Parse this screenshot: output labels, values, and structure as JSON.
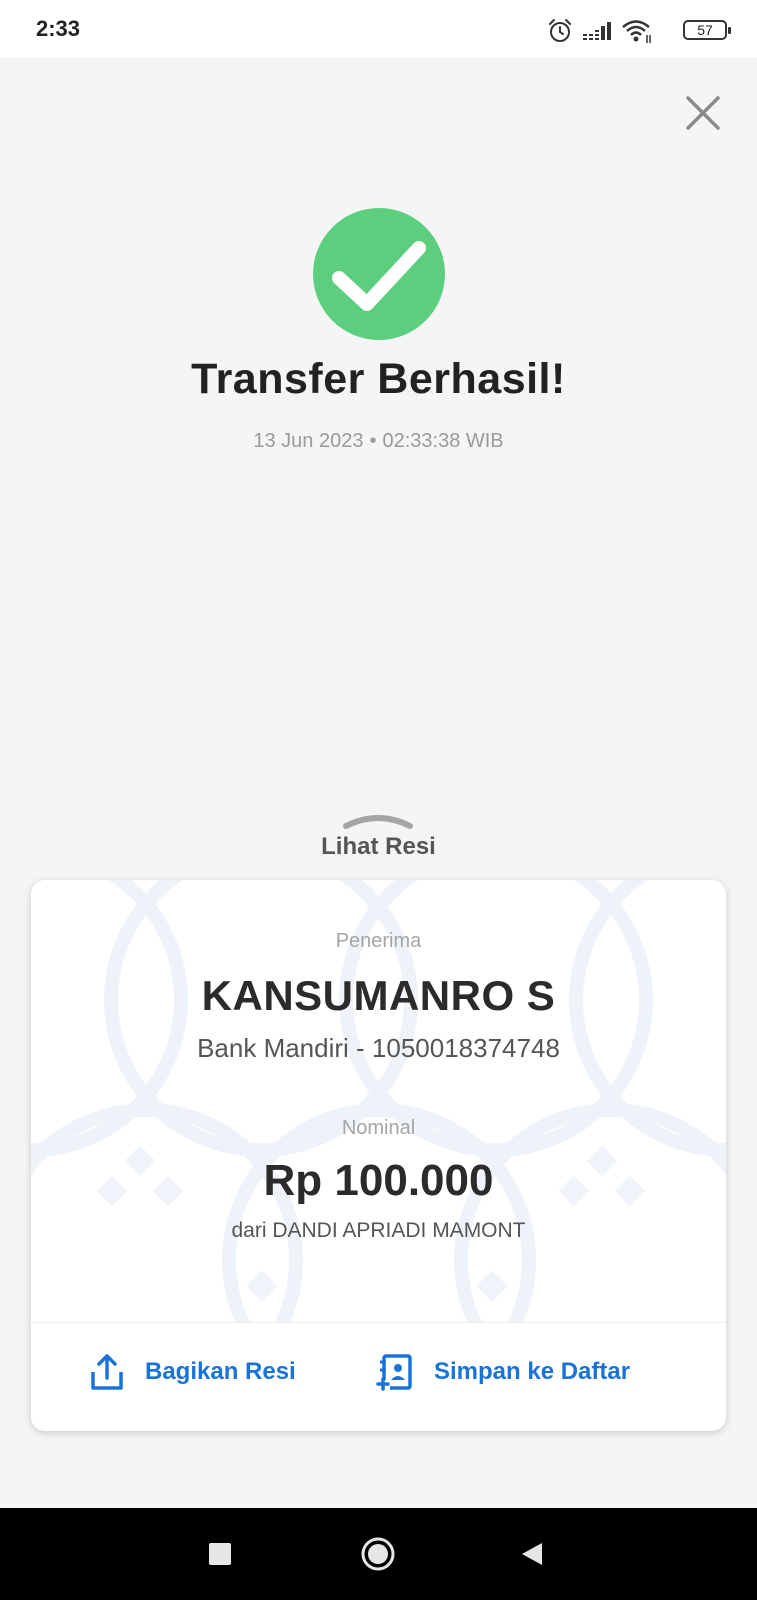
{
  "status_bar": {
    "time": "2:33",
    "battery_level": "57",
    "icons": [
      "alarm-icon",
      "signal-icon",
      "wifi-icon",
      "battery-icon"
    ]
  },
  "header": {
    "close_icon": "close-icon"
  },
  "success": {
    "icon": "check-circle-icon",
    "color": "#5ccf7f",
    "title": "Transfer Berhasil!",
    "date": "13 Jun 2023",
    "separator": "•",
    "time": "02:33:38 WIB"
  },
  "receipt_toggle": {
    "label": "Lihat Resi",
    "icon": "chevron-up-icon"
  },
  "card": {
    "recipient_label": "Penerima",
    "recipient_name": "KANSUMANRO S",
    "bank_info": "Bank Mandiri - 1050018374748",
    "amount_label": "Nominal",
    "amount": "Rp 100.000",
    "sender": "dari DANDI APRIADI MAMONT"
  },
  "actions": {
    "share_label": "Bagikan Resi",
    "share_icon": "share-upload-icon",
    "save_label": "Simpan ke Daftar",
    "save_icon": "add-contact-icon",
    "color": "#1a73d9"
  },
  "nav_bar": {
    "buttons": [
      "recents-square-icon",
      "home-circle-icon",
      "back-triangle-icon"
    ]
  }
}
